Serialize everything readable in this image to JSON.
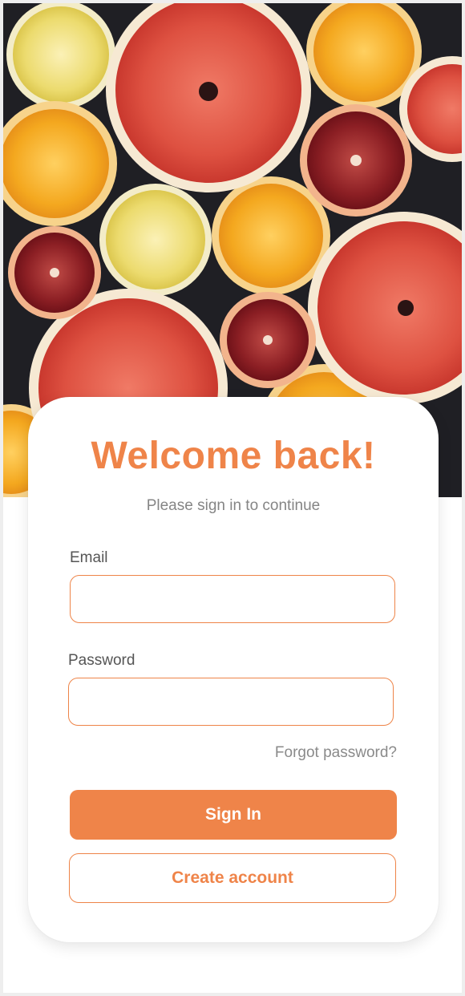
{
  "hero": {
    "image_name": "citrus-slices-photo",
    "colors": {
      "background": "#1f1f24",
      "grapefruit": "#d94a3c",
      "blood_orange": "#8c1f24",
      "orange": "#f2a523",
      "lemon": "#e9d86c",
      "rind": "#f6e9d3"
    }
  },
  "login": {
    "title": "Welcome back!",
    "subtitle": "Please sign in to continue",
    "email_label": "Email",
    "email_value": "",
    "password_label": "Password",
    "password_value": "",
    "forgot_label": "Forgot password?",
    "sign_in_label": "Sign In",
    "create_account_label": "Create account"
  },
  "theme": {
    "accent": "#ef8449",
    "text_muted": "#858585",
    "card_bg": "#ffffff"
  }
}
